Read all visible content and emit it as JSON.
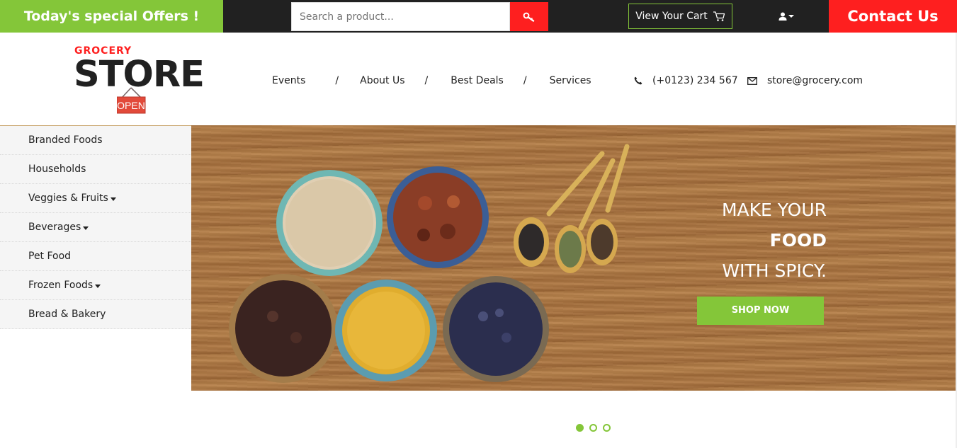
{
  "topbar": {
    "offers_label": "Today's special Offers !",
    "search_placeholder": "Search a product...",
    "cart_label": "View Your Cart",
    "contact_label": "Contact Us"
  },
  "logo": {
    "small": "GROCERY",
    "big": "STORE",
    "sign": "OPEN"
  },
  "nav": {
    "items": [
      "Events",
      "About Us",
      "Best Deals",
      "Services"
    ],
    "separator": "/"
  },
  "contact": {
    "phone": "(+0123) 234 567",
    "email": "store@grocery.com"
  },
  "sidebar": {
    "items": [
      {
        "label": "Branded Foods",
        "dropdown": false
      },
      {
        "label": "Households",
        "dropdown": false
      },
      {
        "label": "Veggies & Fruits",
        "dropdown": true
      },
      {
        "label": "Beverages",
        "dropdown": true
      },
      {
        "label": "Pet Food",
        "dropdown": false
      },
      {
        "label": "Frozen Foods",
        "dropdown": true
      },
      {
        "label": "Bread & Bakery",
        "dropdown": false
      }
    ]
  },
  "banner": {
    "line1": "MAKE YOUR",
    "line2": "FOOD",
    "line3": "WITH SPICY.",
    "cta": "SHOP NOW"
  },
  "carousel": {
    "slides": 3,
    "active_index": 0
  },
  "colors": {
    "accent_green": "#84c639",
    "accent_red": "#fe1f1f",
    "dark": "#212121"
  }
}
